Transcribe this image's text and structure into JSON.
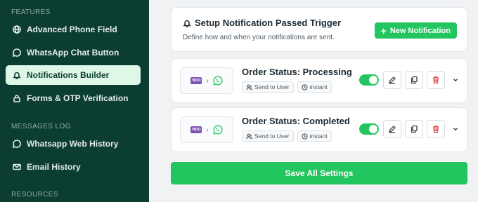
{
  "sidebar": {
    "features_label": "FEATURES",
    "items": [
      {
        "label": "Advanced Phone Field",
        "icon": "globe-icon"
      },
      {
        "label": "WhatsApp Chat Button",
        "icon": "whatsapp-icon"
      },
      {
        "label": "Notifications Builder",
        "icon": "bell-icon",
        "active": true
      },
      {
        "label": "Forms & OTP Verification",
        "icon": "lock-icon"
      }
    ],
    "messages_label": "MESSAGES LOG",
    "log_items": [
      {
        "label": "Whatsapp Web History",
        "icon": "whatsapp-icon"
      },
      {
        "label": "Email History",
        "icon": "mail-icon"
      }
    ],
    "resources_label": "RESOURCES"
  },
  "header": {
    "title": "Setup Notification Passed Trigger",
    "subtitle": "Define how and when your notifications are sent.",
    "new_button": "New Notification"
  },
  "triggers": [
    {
      "title": "Order Status: Processing",
      "chip_send": "Send to User",
      "chip_time": "instant",
      "enabled": true,
      "woo_text": "WOO"
    },
    {
      "title": "Order Status: Completed",
      "chip_send": "Send to User",
      "chip_time": "instant",
      "enabled": true,
      "woo_text": "WOO"
    }
  ],
  "save_button": "Save All Settings",
  "colors": {
    "sidebar_bg": "#0c3d33",
    "accent": "#22c55e",
    "active_bg": "#dff7e6",
    "delete": "#e0483e"
  }
}
